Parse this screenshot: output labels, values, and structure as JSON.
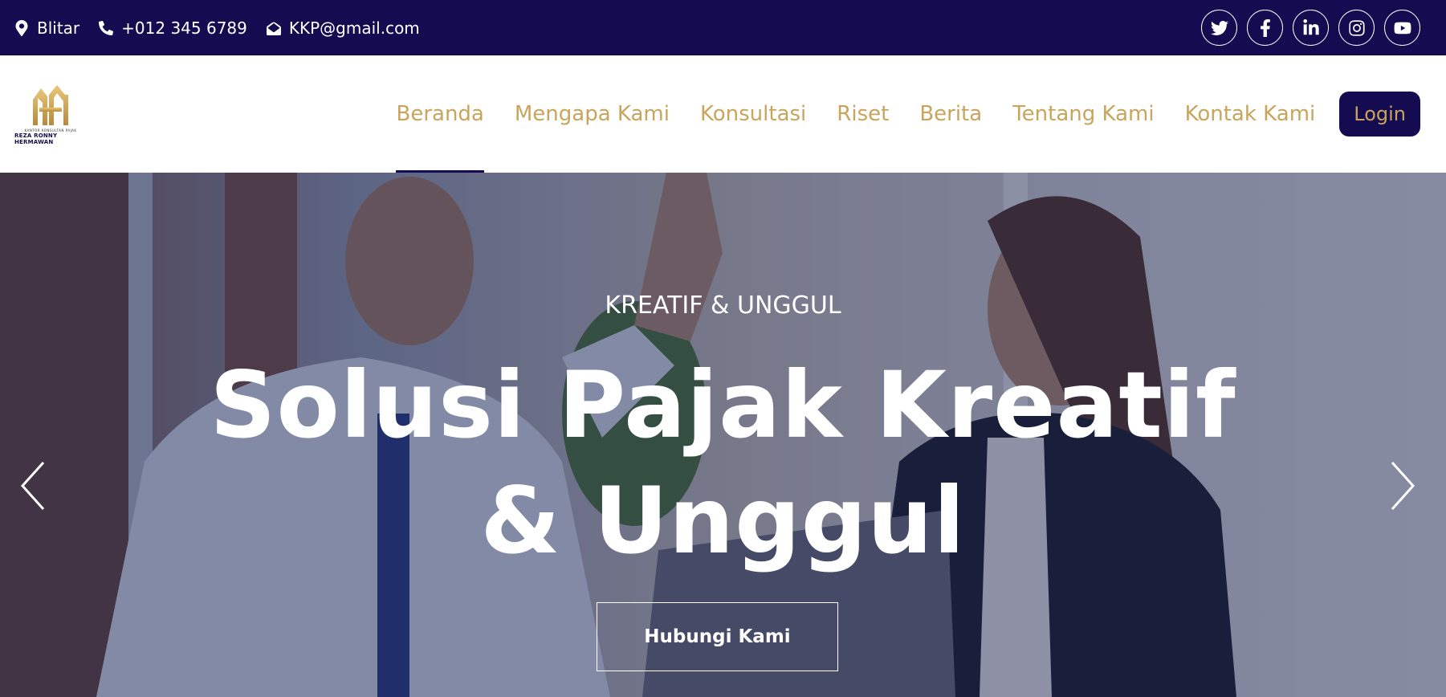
{
  "topbar": {
    "location": "Blitar",
    "phone": "+012 345 6789",
    "email": "KKP@gmail.com",
    "socials": [
      "twitter-icon",
      "facebook-icon",
      "linkedin-icon",
      "instagram-icon",
      "youtube-icon"
    ]
  },
  "logo": {
    "line1": "KANTOR KONSULTAN PAJAK",
    "line2": "REZA RONNY HERMAWAN"
  },
  "nav": {
    "items": [
      "Beranda",
      "Mengapa Kami",
      "Konsultasi",
      "Riset",
      "Berita",
      "Tentang Kami",
      "Kontak Kami"
    ],
    "active": "Beranda",
    "login_label": "Login"
  },
  "hero": {
    "subtitle": "KREATIF & UNGGUL",
    "title": "Solusi Pajak Kreatif & Unggul",
    "cta_label": "Hubungi Kami"
  },
  "colors": {
    "primary": "#140b50",
    "accent": "#c9a45c",
    "white": "#ffffff"
  }
}
